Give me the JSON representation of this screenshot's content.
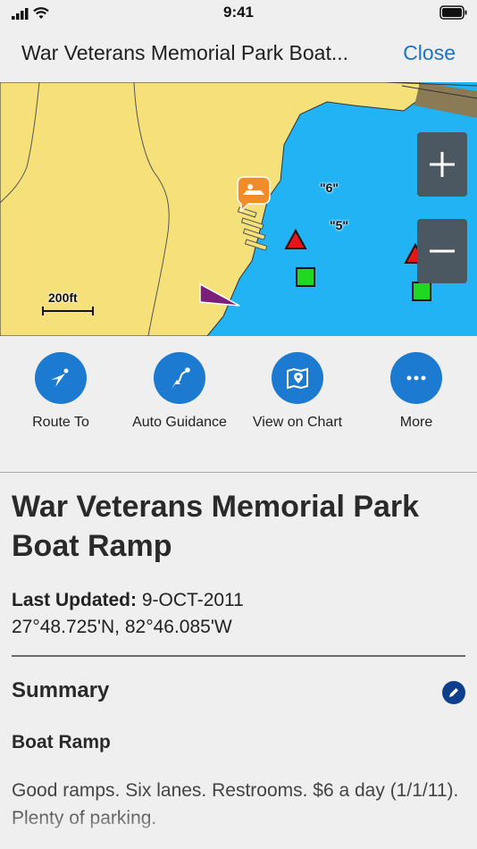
{
  "status_bar": {
    "time": "9:41"
  },
  "nav": {
    "title": "War Veterans Memorial Park Boat...",
    "close_label": "Close"
  },
  "map": {
    "scale_label": "200ft",
    "depth_labels": [
      "\"6\"",
      "\"5\""
    ],
    "zoom_in_icon": "plus-icon",
    "zoom_out_icon": "minus-icon",
    "colors": {
      "land": "#f6e07a",
      "water": "#22b3f4",
      "marker_red": "#e8141b",
      "marker_green": "#1fd81f",
      "poi": "#f28c28",
      "hazard": "#7a1f7a"
    }
  },
  "actions": [
    {
      "label": "Route To",
      "icon": "navigation-arrow-icon"
    },
    {
      "label": "Auto Guidance",
      "icon": "route-path-icon"
    },
    {
      "label": "View on Chart",
      "icon": "map-pin-icon"
    },
    {
      "label": "More",
      "icon": "more-dots-icon"
    }
  ],
  "detail": {
    "title": "War Veterans Memorial Park Boat Ramp",
    "last_updated_label": "Last Updated:",
    "last_updated_value": "9-OCT-2011",
    "coordinates": "27°48.725'N, 82°46.085'W",
    "summary_heading": "Summary",
    "subheading": "Boat Ramp",
    "body": "Good ramps.  Six lanes.  Restrooms.  $6 a day (1/1/11).  Plenty of parking."
  }
}
